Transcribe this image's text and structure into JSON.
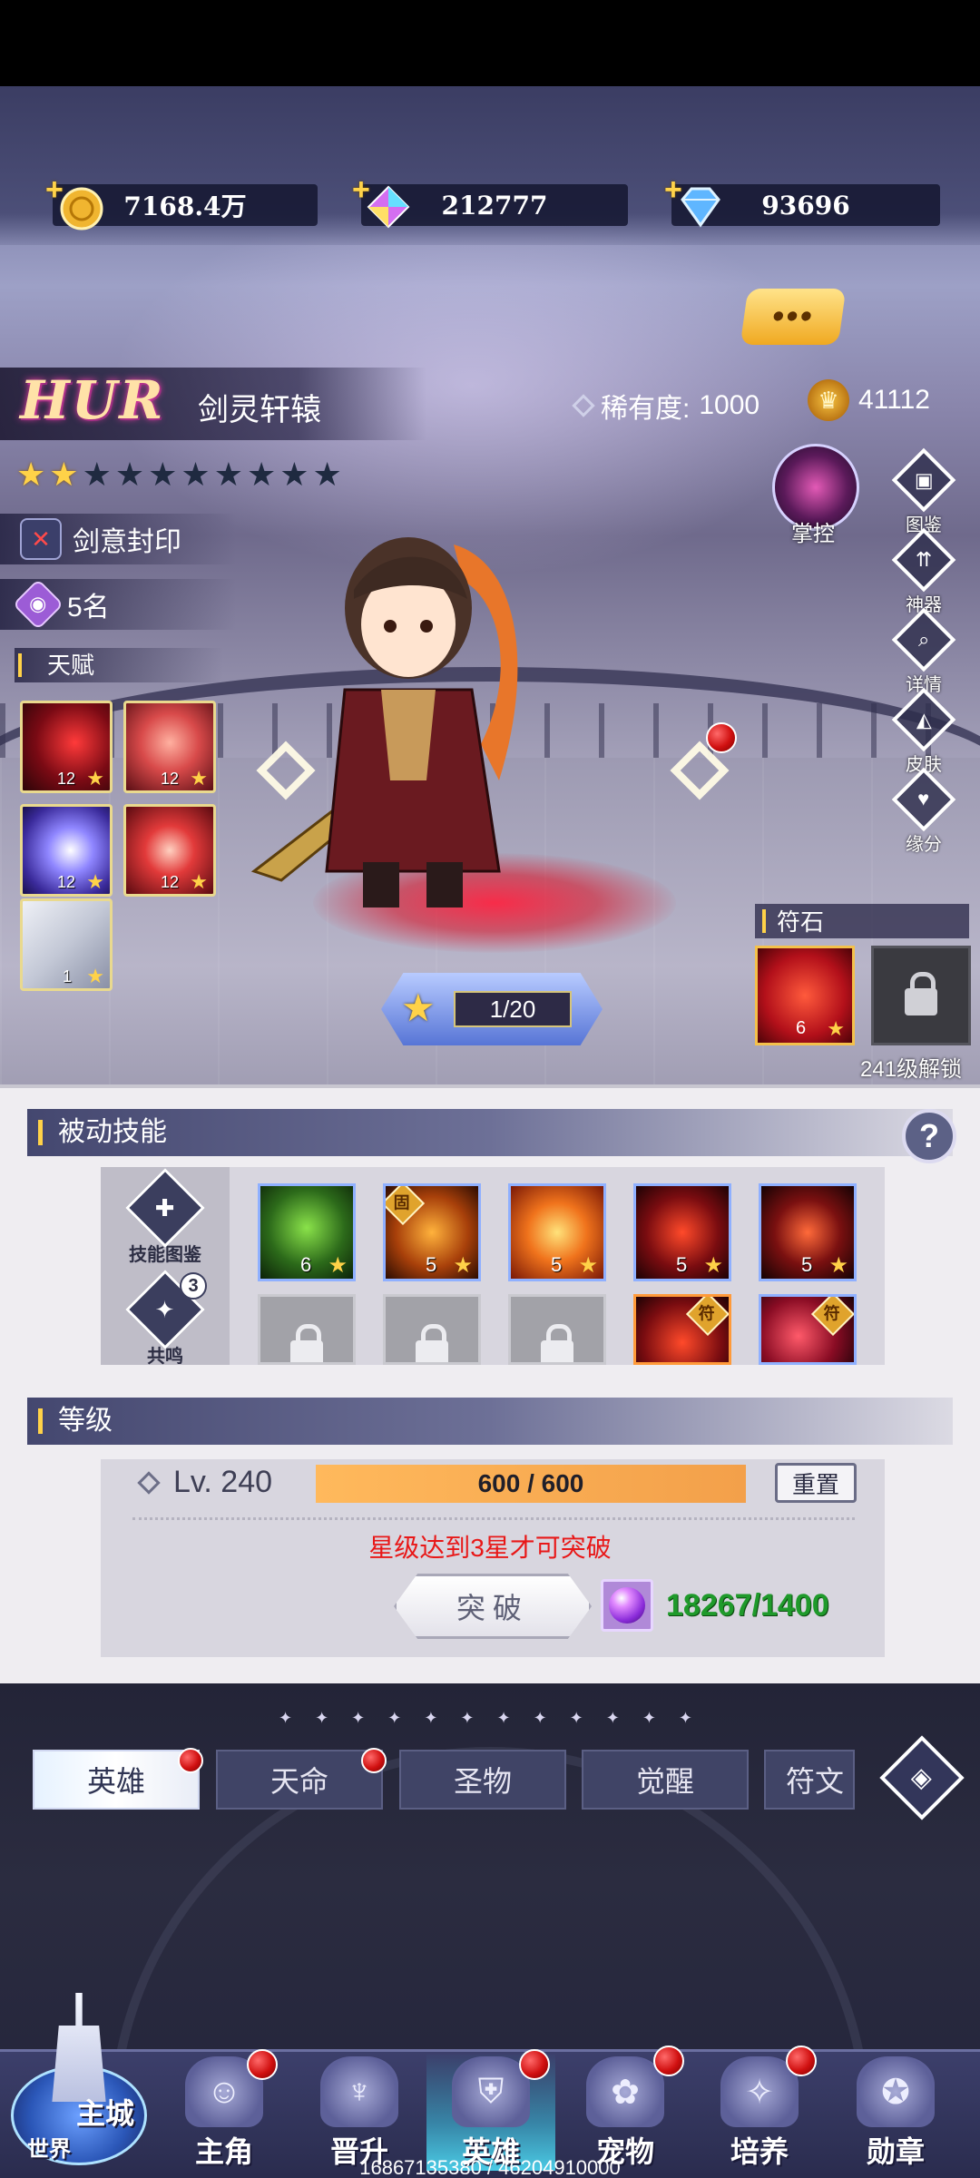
{
  "currencies": [
    {
      "icon": "gold-coin-icon",
      "value": "7168.4万"
    },
    {
      "icon": "rainbow-gem-icon",
      "value": "212777"
    },
    {
      "icon": "blue-diamond-icon",
      "value": "93696"
    }
  ],
  "hero": {
    "grade": "HUR",
    "name": "剑灵轩辕",
    "rarity_label": "稀有度:",
    "rarity_value": "1000",
    "power": "41112",
    "stars_filled": 2,
    "stars_total": 10,
    "faction": "剑意封印",
    "rank": "5名",
    "control_label": "掌控"
  },
  "talents": {
    "label": "天赋",
    "items": [
      {
        "level": "12"
      },
      {
        "level": "12"
      },
      {
        "level": "12"
      },
      {
        "level": "12"
      },
      {
        "level": "1"
      }
    ]
  },
  "side_buttons": [
    "图鉴",
    "神器",
    "详情",
    "皮肤",
    "缘分"
  ],
  "star_progress": "1/20",
  "runes": {
    "label": "符石",
    "slot1_level": "6",
    "unlock_text": "241级解锁"
  },
  "passive": {
    "title": "被动技能",
    "codex_label": "技能图鉴",
    "resonance_label": "共鸣",
    "resonance_count": "3",
    "skills": [
      {
        "level": "6",
        "tag": ""
      },
      {
        "level": "5",
        "tag": "固"
      },
      {
        "level": "5",
        "tag": ""
      },
      {
        "level": "5",
        "tag": ""
      },
      {
        "level": "5",
        "tag": ""
      }
    ],
    "row2_tags": [
      "符",
      "符"
    ]
  },
  "level": {
    "title": "等级",
    "lv_text": "Lv. 240",
    "exp_text": "600 / 600",
    "exp_fraction": 1.0,
    "reset_label": "重置",
    "warning": "星级达到3星才可突破",
    "break_label": "突破",
    "material_count": "18267/1400"
  },
  "separator": "✦ ✦ ✦ ✦ ✦ ✦ ✦ ✦ ✦ ✦ ✦ ✦",
  "tabs": [
    "英雄",
    "天命",
    "圣物",
    "觉醒",
    "符文"
  ],
  "nav": {
    "castle_top": "主城",
    "castle_bottom": "世界",
    "items": [
      "主角",
      "晋升",
      "英雄",
      "宠物",
      "培养",
      "勋章"
    ]
  },
  "footer_numbers": "16867135380 / 46204910000",
  "colors": {
    "accent_gold": "#ffd248",
    "warn_red": "#e81818",
    "material_green": "#1f9a2b",
    "badge_red": "#d01010"
  }
}
